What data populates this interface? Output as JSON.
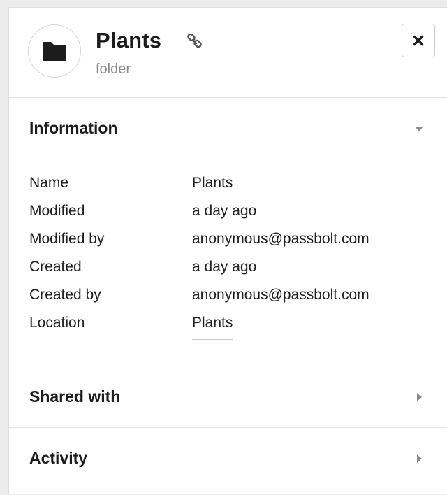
{
  "header": {
    "title": "Plants",
    "subtitle": "folder",
    "icon": "folder-icon",
    "link_icon": "link-icon",
    "close_icon": "close-icon"
  },
  "information": {
    "title": "Information",
    "expanded": true,
    "rows": [
      {
        "label": "Name",
        "value": "Plants"
      },
      {
        "label": "Modified",
        "value": "a day ago"
      },
      {
        "label": "Modified by",
        "value": "anonymous@passbolt.com"
      },
      {
        "label": "Created",
        "value": "a day ago"
      },
      {
        "label": "Created by",
        "value": "anonymous@passbolt.com"
      },
      {
        "label": "Location",
        "value": "Plants"
      }
    ]
  },
  "shared_with": {
    "title": "Shared with",
    "expanded": false
  },
  "activity": {
    "title": "Activity",
    "expanded": false
  },
  "colors": {
    "text": "#1f1f1f",
    "muted": "#8c8c8c",
    "border": "#e3e3e3",
    "caret": "#8a8a8a"
  }
}
